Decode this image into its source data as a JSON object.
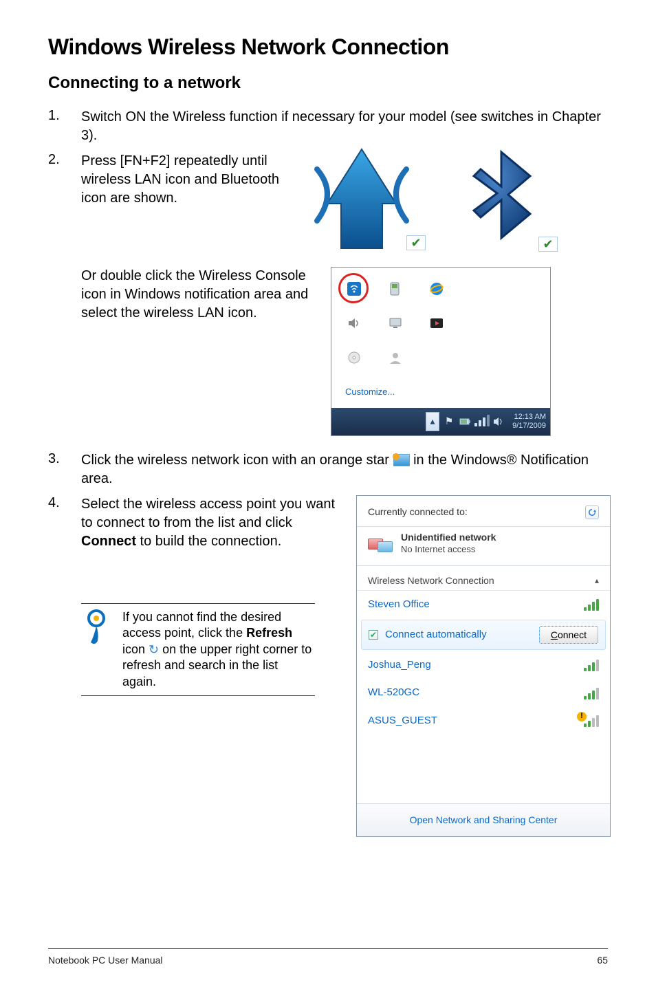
{
  "header": {
    "title": "Windows Wireless Network Connection",
    "subtitle": "Connecting to a network"
  },
  "steps": {
    "1": {
      "num": "1.",
      "text": "Switch ON the Wireless function if necessary for your model (see switches in Chapter 3)."
    },
    "2": {
      "num": "2.",
      "text": "Press [FN+F2] repeatedly until wireless LAN icon and Bluetooth icon are shown."
    },
    "2b": {
      "text": "Or double click the Wireless Console icon in Windows notification area and select the wireless LAN icon."
    },
    "3": {
      "num": "3.",
      "text_a": "Click the wireless network icon with an orange star ",
      "text_b": " in the Windows® Notification area."
    },
    "4": {
      "num": "4.",
      "text_a": "Select the wireless access point you want to connect to from the list and click ",
      "bold": "Connect",
      "text_b": " to build the connection."
    }
  },
  "note": {
    "text_a": "If you cannot find the desired access point, click the ",
    "bold": "Refresh",
    "text_b": " icon ",
    "text_c": " on the upper right corner to refresh and search in the list again."
  },
  "tray": {
    "customize": "Customize...",
    "time": "12:13 AM",
    "date": "9/17/2009"
  },
  "flyout": {
    "currently": "Currently connected to:",
    "net_name": "Unidentified network",
    "net_status": "No Internet access",
    "section": "Wireless Network Connection",
    "items": {
      "0": {
        "name": "Steven Office"
      },
      "1": {
        "checkbox_label": "Connect automatically",
        "connect_C": "C",
        "connect_rest": "onnect"
      },
      "2": {
        "name": "Joshua_Peng"
      },
      "3": {
        "name": "WL-520GC"
      },
      "4": {
        "name": "ASUS_GUEST"
      }
    },
    "open_center": "Open Network and Sharing Center"
  },
  "footer": {
    "left": "Notebook PC User Manual",
    "right": "65"
  }
}
